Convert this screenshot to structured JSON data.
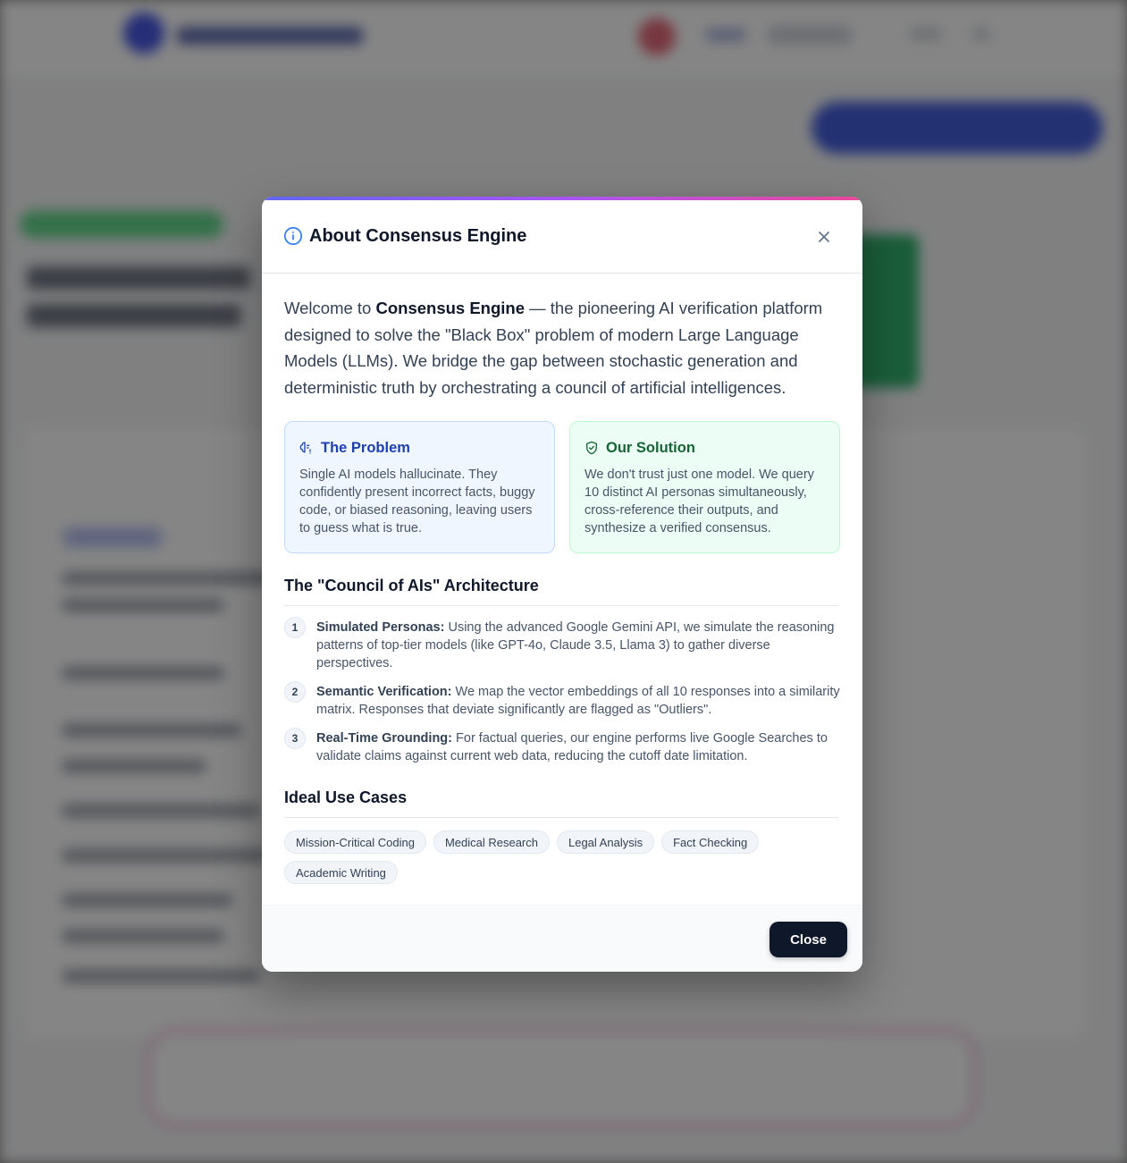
{
  "modal": {
    "title": "About Consensus Engine",
    "close_icon": "close-icon",
    "intro": {
      "prefix": "Welcome to ",
      "brand": "Consensus Engine",
      "body": " — the pioneering AI verification platform designed to solve the \"Black Box\" problem of modern Large Language Models (LLMs). We bridge the gap between stochastic generation and deterministic truth by orchestrating a council of artificial intelligences."
    },
    "problem": {
      "title": "The Problem",
      "text": "Single AI models hallucinate. They confidently present incorrect facts, buggy code, or biased reasoning, leaving users to guess what is true."
    },
    "solution": {
      "title": "Our Solution",
      "text": "We don't trust just one model. We query 10 distinct AI personas simultaneously, cross-reference their outputs, and synthesize a verified consensus."
    },
    "architecture": {
      "title": "The \"Council of AIs\" Architecture",
      "steps": [
        {
          "number": "1",
          "label": "Simulated Personas:",
          "text": " Using the advanced Google Gemini API, we simulate the reasoning patterns of top-tier models (like GPT-4o, Claude 3.5, Llama 3) to gather diverse perspectives."
        },
        {
          "number": "2",
          "label": "Semantic Verification:",
          "text": " We map the vector embeddings of all 10 responses into a similarity matrix. Responses that deviate significantly are flagged as \"Outliers\"."
        },
        {
          "number": "3",
          "label": "Real-Time Grounding:",
          "text": " For factual queries, our engine performs live Google Searches to validate claims against current web data, reducing the cutoff date limitation."
        }
      ]
    },
    "use_cases": {
      "title": "Ideal Use Cases",
      "tags": [
        "Mission-Critical Coding",
        "Medical Research",
        "Legal Analysis",
        "Fact Checking",
        "Academic Writing"
      ]
    },
    "footer": {
      "close_label": "Close"
    }
  },
  "colors": {
    "accent_gradient": [
      "#6366f1",
      "#a855f7",
      "#ec4899"
    ],
    "problem_bg": "#eff6ff",
    "solution_bg": "#ecfdf5",
    "primary_button": "#0f172a"
  }
}
